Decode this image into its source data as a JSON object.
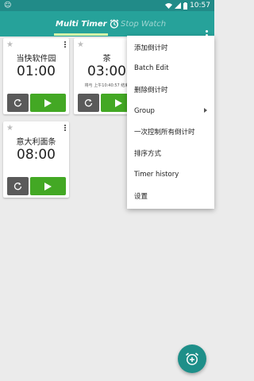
{
  "status_bar": {
    "left_text": "☺",
    "time": "10:57"
  },
  "tabs": [
    {
      "label": "Multi Timer"
    },
    {
      "label": "Stop Watch"
    }
  ],
  "cards": [
    {
      "name": "当快软件园",
      "time": "01:00",
      "subtitle": "",
      "starred": false
    },
    {
      "name": "茶",
      "time": "03:00",
      "subtitle": "将与 上午10:40:57 结束",
      "starred": false
    },
    {
      "name": "意大利面条",
      "time": "08:00",
      "subtitle": "",
      "starred": false
    }
  ],
  "menu": {
    "items": [
      {
        "label": "添加倒计时"
      },
      {
        "label": "Batch Edit"
      },
      {
        "label": "删除倒计时"
      },
      {
        "label": "Group"
      },
      {
        "label": "一次控制所有倒计时"
      },
      {
        "label": "排序方式"
      },
      {
        "label": "Timer history"
      },
      {
        "label": "设置"
      }
    ]
  },
  "colors": {
    "app_bar": "#26a29a",
    "status_bar": "#218b88",
    "play": "#43a824",
    "reset": "#5a5a5a",
    "fab": "#1e8f89",
    "tab_indicator": "#d3f2a8"
  },
  "icons": {
    "reset": "refresh-icon",
    "play": "play-icon",
    "fab": "add-alarm-icon",
    "tab_timer": "alarm-icon",
    "tab_stopwatch": "stopwatch-icon"
  }
}
